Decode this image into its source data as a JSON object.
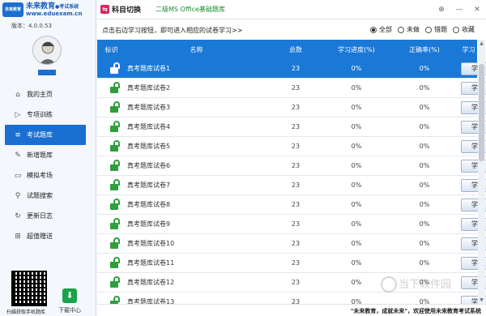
{
  "brand": {
    "name": "未来教育",
    "suffix": "●考试系统",
    "url": "www.eduexam.cn",
    "logo_text": "未来教育",
    "version": "版本：4.0.0.53"
  },
  "sidebar": {
    "items": [
      {
        "label": "我的主页",
        "icon": "home-icon",
        "glyph": "⌂"
      },
      {
        "label": "专项训练",
        "icon": "play-icon",
        "glyph": "▷"
      },
      {
        "label": "考试题库",
        "icon": "list-icon",
        "glyph": "≡"
      },
      {
        "label": "新增题库",
        "icon": "edit-icon",
        "glyph": "✎"
      },
      {
        "label": "模拟考场",
        "icon": "monitor-icon",
        "glyph": "▭"
      },
      {
        "label": "试题搜索",
        "icon": "search-icon",
        "glyph": "⚲"
      },
      {
        "label": "更新日志",
        "icon": "refresh-icon",
        "glyph": "↻"
      },
      {
        "label": "超值赠送",
        "icon": "gift-icon",
        "glyph": "⊞"
      }
    ],
    "active_index": 2,
    "qr_caption": "扫描获取手机题库",
    "download_label": "下载中心"
  },
  "topbar": {
    "switch_label": "科目切换",
    "subject": "二级MS Office基础题库",
    "controls": [
      "⊕",
      "—",
      "✕"
    ]
  },
  "toolbar": {
    "hint": "点击右边学习按钮，即可进入相应的试卷学习>>",
    "filters": [
      {
        "label": "全部",
        "checked": true
      },
      {
        "label": "未做",
        "checked": false
      },
      {
        "label": "错题",
        "checked": false
      },
      {
        "label": "收藏",
        "checked": false
      }
    ]
  },
  "table": {
    "headers": {
      "flag": "标识",
      "name": "名称",
      "total": "总数",
      "progress": "学习进度(%)",
      "accuracy": "正确率(%)",
      "action": "学习"
    },
    "rows": [
      {
        "name": "真考题库试卷1",
        "total": "23",
        "progress": "0%",
        "accuracy": "0%",
        "action": "学习"
      },
      {
        "name": "真考题库试卷2",
        "total": "23",
        "progress": "0%",
        "accuracy": "0%",
        "action": "学习"
      },
      {
        "name": "真考题库试卷3",
        "total": "23",
        "progress": "0%",
        "accuracy": "0%",
        "action": "学习"
      },
      {
        "name": "真考题库试卷4",
        "total": "23",
        "progress": "0%",
        "accuracy": "0%",
        "action": "学习"
      },
      {
        "name": "真考题库试卷5",
        "total": "23",
        "progress": "0%",
        "accuracy": "0%",
        "action": "学习"
      },
      {
        "name": "真考题库试卷6",
        "total": "23",
        "progress": "0%",
        "accuracy": "0%",
        "action": "学习"
      },
      {
        "name": "真考题库试卷7",
        "total": "23",
        "progress": "0%",
        "accuracy": "0%",
        "action": "学习"
      },
      {
        "name": "真考题库试卷8",
        "total": "23",
        "progress": "0%",
        "accuracy": "0%",
        "action": "学习"
      },
      {
        "name": "真考题库试卷9",
        "total": "23",
        "progress": "0%",
        "accuracy": "0%",
        "action": "学习"
      },
      {
        "name": "真考题库试卷10",
        "total": "23",
        "progress": "0%",
        "accuracy": "0%",
        "action": "学习"
      },
      {
        "name": "真考题库试卷11",
        "total": "23",
        "progress": "0%",
        "accuracy": "0%",
        "action": "学习"
      },
      {
        "name": "真考题库试卷12",
        "total": "23",
        "progress": "0%",
        "accuracy": "0%",
        "action": "学习"
      },
      {
        "name": "真考题库试卷13",
        "total": "23",
        "progress": "0%",
        "accuracy": "0%",
        "action": "学习"
      }
    ],
    "selected_index": 0
  },
  "footer": {
    "text": "\"未来教育，成就未来\"，欢迎使用未来教育考试系统"
  },
  "watermark": "当下软件园",
  "colors": {
    "accent": "#1a78d6",
    "lock": "#2e9e3f",
    "subject": "#1a8b2e"
  }
}
